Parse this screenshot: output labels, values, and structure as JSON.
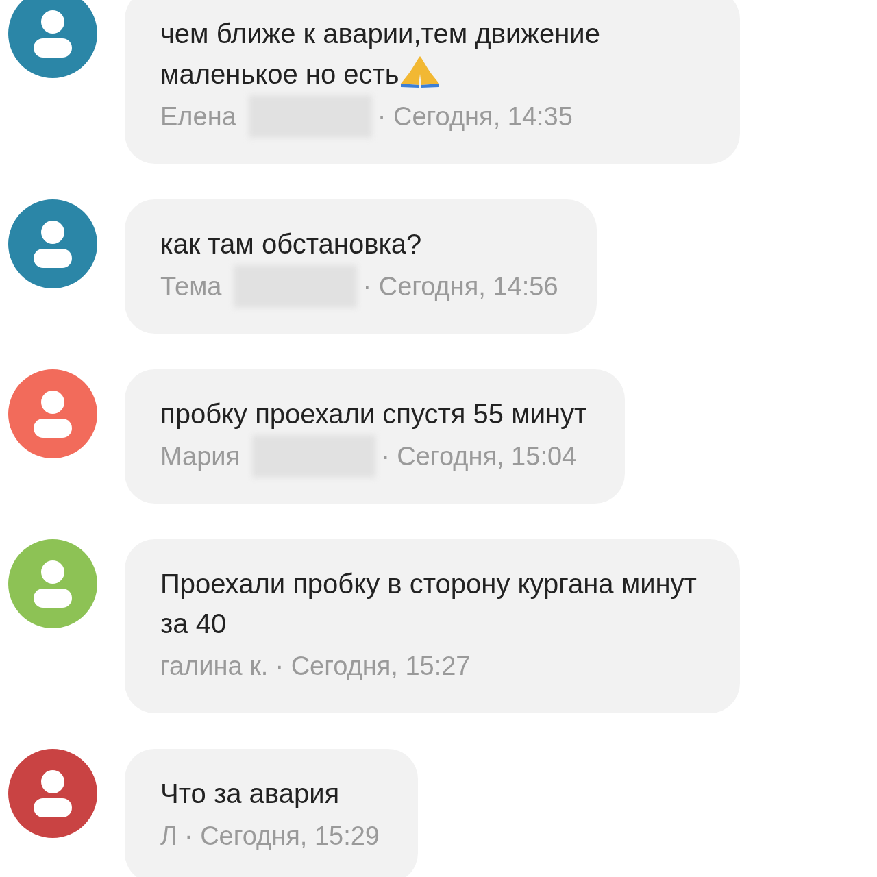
{
  "messages": [
    {
      "color": "#2b86a7",
      "text": "чем ближе к аварии,тем движение маленькое но есть",
      "emoji": true,
      "author": "Елена",
      "redacted": true,
      "time": "· Сегодня, 14:35"
    },
    {
      "color": "#2b86a7",
      "text": "как там обстановка?",
      "emoji": false,
      "author": "Тема",
      "redacted": true,
      "time": "· Сегодня, 14:56"
    },
    {
      "color": "#f26b5b",
      "text": "пробку проехали спустя 55 минут",
      "emoji": false,
      "author": "Мария",
      "redacted": true,
      "time": "· Сегодня, 15:04"
    },
    {
      "color": "#8dc255",
      "text": "Проехали пробку в сторону кургана минут за 40",
      "emoji": false,
      "author": "галина к.",
      "redacted": false,
      "time": "· Сегодня, 15:27"
    },
    {
      "color": "#c94343",
      "text": "Что за авария",
      "emoji": false,
      "author": "Л",
      "redacted": false,
      "time": "· Сегодня, 15:29"
    }
  ]
}
